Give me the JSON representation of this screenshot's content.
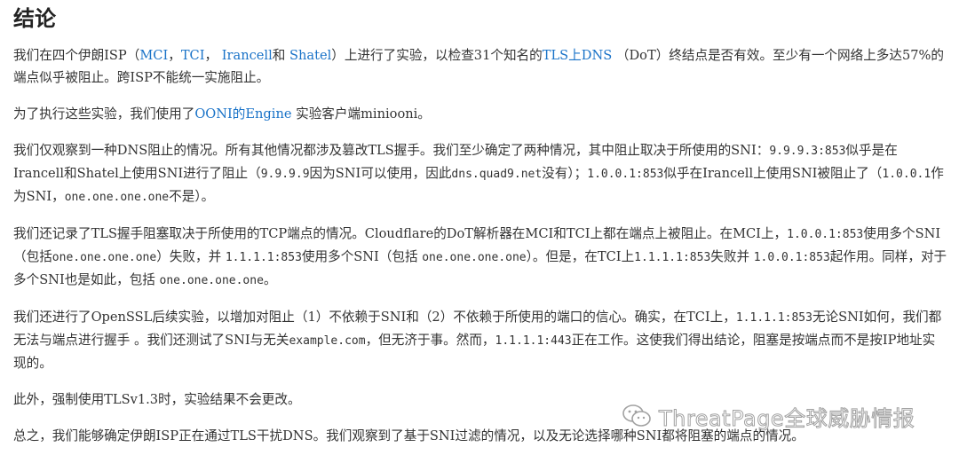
{
  "title": "结论",
  "p1": {
    "t1": "我们在四个伊朗ISP（",
    "l1": "MCI",
    "t2": "，",
    "l2": "TCI",
    "t3": "，",
    "l3": "Irancell",
    "t4": "和 ",
    "l4": "Shatel",
    "t5": "）上进行了实验，以检查31个知名的",
    "l5": "TLS上DNS",
    "t6": "（DoT）终结点是否有效。至少有一个网络上多达57%的端点似乎被阻止。跨ISP不能统一实施阻止。"
  },
  "p2": {
    "t1": "为了执行这些实验，我们使用了",
    "l1": "OONI的Engine",
    "t2": " 实验客户端miniooni。"
  },
  "p3": {
    "t1": "我们仅观察到一种DNS阻止的情况。所有其他情况都涉及篡改TLS握手。我们至少确定了两种情况，其中阻止取决于所使用的SNI：",
    "m1": "9.9.9.3:853",
    "t2": "似乎是在Irancell和Shatel上使用SNI进行了阻止（",
    "m2": "9.9.9.9",
    "t3": "因为SNI可以使用，因此",
    "m3": "dns.quad9.net",
    "t4": "没有）；",
    "m4": "1.0.0.1:853",
    "t5": "似乎在Irancell上使用SNI被阻止了（",
    "m5": "1.0.0.1",
    "t6": "作为SNI，",
    "m6": "one.one.one.one",
    "t7": "不是）。"
  },
  "p4": {
    "t1": "我们还记录了TLS握手阻塞取决于所使用的TCP端点的情况。Cloudflare的DoT解析器在MCI和TCI上都在端点上被阻止。在MCI上，",
    "m1": "1.0.0.1:853",
    "t2": "使用多个SNI（包括",
    "m2": "one.one.one.one",
    "t3": "）失败，并 ",
    "m3": "1.1.1.1:853",
    "t4": "使用多个SNI（包括 ",
    "m4": "one.one.one.one",
    "t5": "）。但是，在TCI上",
    "m5": "1.1.1.1:853",
    "t6": "失败并 ",
    "m6": "1.0.0.1:853",
    "t7": "起作用。同样，对于多个SNI也是如此，包括 ",
    "m7": "one.one.one.one",
    "t8": "。"
  },
  "p5": {
    "t1": "我们还进行了OpenSSL后续实验，以增加对阻止（1）不依赖于SNI和（2）不依赖于所使用的端口的信心。确实，在TCI上，",
    "m1": "1.1.1.1:853",
    "t2": "无论SNI如何，我们都无法与端点进行握手 。我们还测试了SNI与无关",
    "m2": "example.com",
    "t3": "，但无济于事。然而，",
    "m3": "1.1.1.1:443",
    "t4": "正在工作。这使我们得出结论，阻塞是按端点而不是按IP地址实现的。"
  },
  "p6": "此外，强制使用TLSv1.3时，实验结果不会更改。",
  "p7": "总之，我们能够确定伊朗ISP正在通过TLS干扰DNS。我们观察到了基于SNI过滤的情况，以及无论选择哪种SNI都将阻塞的端点的情况。",
  "watermark": {
    "text": "ThreatPage全球威胁情报",
    "icon": "wechat-icon"
  },
  "colors": {
    "link": "#1a73c8",
    "text": "#333333",
    "heading": "#222222"
  }
}
